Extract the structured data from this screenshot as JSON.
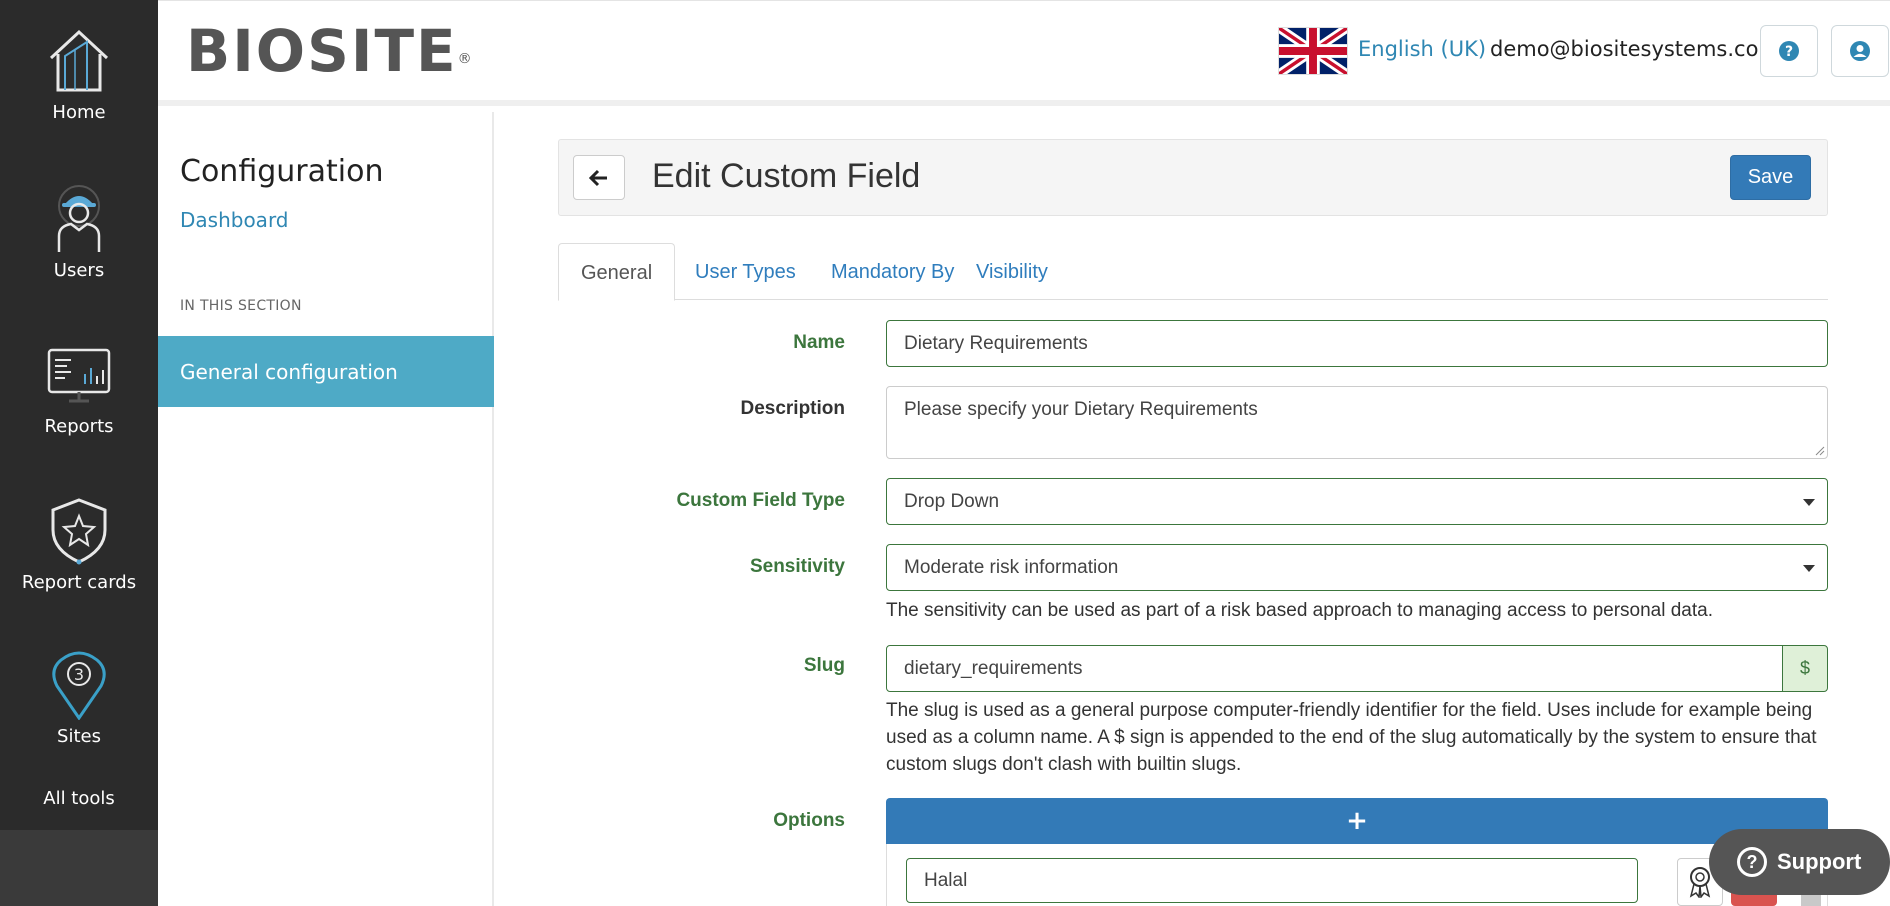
{
  "nav": {
    "items": [
      {
        "label": "Home",
        "icon": "home-icon"
      },
      {
        "label": "Users",
        "icon": "worker-icon"
      },
      {
        "label": "Reports",
        "icon": "reports-icon"
      },
      {
        "label": "Report cards",
        "icon": "shield-star-icon"
      },
      {
        "label": "Sites",
        "icon": "location-pin-icon"
      },
      {
        "label": "All tools"
      }
    ]
  },
  "header": {
    "logo_text": "BIOSITE",
    "logo_mark": "®",
    "language": "English (UK)",
    "user_email": "demo@biositesystems.com",
    "help_icon": "question-circle-icon",
    "account_icon": "user-circle-icon"
  },
  "sidebar": {
    "title": "Configuration",
    "dashboard_link": "Dashboard",
    "section_heading": "IN THIS SECTION",
    "active_item": "General configuration"
  },
  "page": {
    "title": "Edit Custom Field",
    "save_label": "Save",
    "tabs": [
      {
        "label": "General",
        "active": true
      },
      {
        "label": "User Types",
        "active": false
      },
      {
        "label": "Mandatory By",
        "active": false
      },
      {
        "label": "Visibility",
        "active": false
      }
    ]
  },
  "form": {
    "name": {
      "label": "Name",
      "value": "Dietary Requirements"
    },
    "description": {
      "label": "Description",
      "value": "Please specify your Dietary Requirements"
    },
    "custom_field_type": {
      "label": "Custom Field Type",
      "value": "Drop Down"
    },
    "sensitivity": {
      "label": "Sensitivity",
      "value": "Moderate risk information",
      "help": "The sensitivity can be used as part of a risk based approach to managing access to personal data."
    },
    "slug": {
      "label": "Slug",
      "value": "dietary_requirements",
      "suffix": "$",
      "help_lines": [
        "The slug is used as a general purpose computer-friendly identifier for the field. Uses include for example being",
        "used as a column name. A $ sign is appended to the end of the slug automatically by the system to ensure that",
        "custom slugs don't clash with builtin slugs."
      ]
    },
    "options": {
      "label": "Options",
      "add_symbol": "+",
      "items": [
        "Halal"
      ]
    }
  },
  "support": {
    "label": "Support",
    "symbol": "?"
  },
  "colors": {
    "nav_bg": "#2b2b2b",
    "accent_blue": "#337ab7",
    "link_blue": "#2f87b3",
    "active_teal": "#4eaac6",
    "success_green": "#3c763d",
    "danger_red": "#d9534f"
  }
}
